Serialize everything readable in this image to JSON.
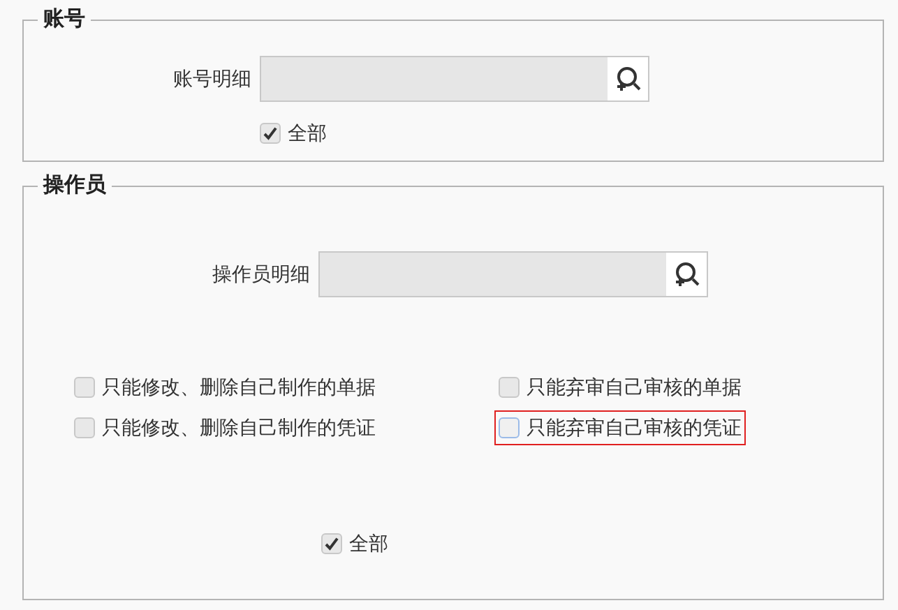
{
  "account": {
    "title": "账号",
    "detail_label": "账号明细",
    "all": {
      "label": "全部",
      "checked": true
    }
  },
  "operator": {
    "title": "操作员",
    "detail_label": "操作员明细",
    "options": [
      {
        "label": "只能修改、删除自己制作的单据",
        "checked": false,
        "highlighted": false
      },
      {
        "label": "只能弃审自己审核的单据",
        "checked": false,
        "highlighted": false
      },
      {
        "label": "只能修改、删除自己制作的凭证",
        "checked": false,
        "highlighted": false
      },
      {
        "label": "只能弃审自己审核的凭证",
        "checked": false,
        "highlighted": true
      }
    ],
    "all": {
      "label": "全部",
      "checked": true
    }
  }
}
